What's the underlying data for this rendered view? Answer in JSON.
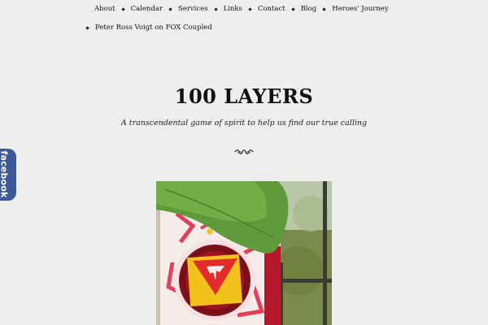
{
  "nav": {
    "row1": [
      "About",
      "Calendar",
      "Services",
      "Links",
      "Contact",
      "Blog",
      "Heroes' Journey"
    ],
    "row2": [
      "Peter Ross Voigt on FOX Coupled"
    ]
  },
  "site": {
    "title": "100 LAYERS",
    "description": "A transcendental game of spirit to help us find our true calling"
  },
  "facebook_tab": {
    "label": "facebook",
    "color": "#3b5998"
  },
  "image": {
    "subject": "stained-glass root chakra symbol behind a green leaf"
  }
}
